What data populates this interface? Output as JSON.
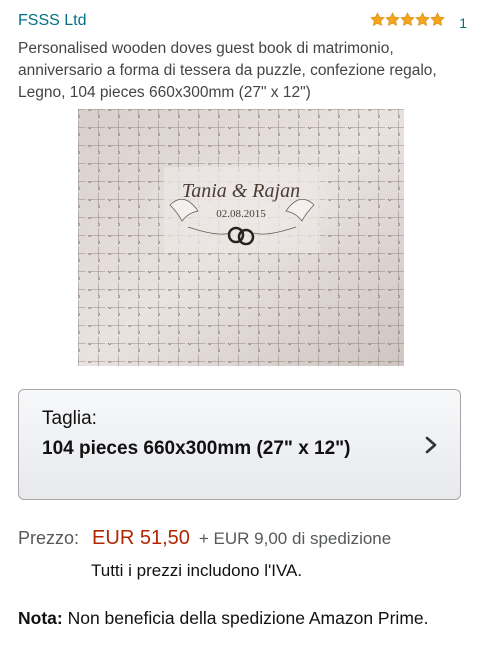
{
  "product": {
    "brand": "FSSS Ltd",
    "rating_count": "1",
    "title": "Personalised wooden doves guest book di matrimonio, anniversario a forma di tessera da puzzle, confezione regalo, Legno, 104 pieces 660x300mm (27\" x 12\")",
    "stars_filled": 5,
    "star_color": "#F4A41D",
    "link_color": "#007185"
  },
  "image": {
    "engraving_names": "Tania & Rajan",
    "engraving_date": "02.08.2015"
  },
  "size_selector": {
    "label": "Taglia:",
    "value": "104 pieces 660x300mm (27\" x 12\")",
    "icon": "chevron-right-icon"
  },
  "pricing": {
    "label": "Prezzo:",
    "price": "EUR 51,50",
    "shipping": "+ EUR 9,00 di spedizione",
    "vat_note": "Tutti i prezzi includono l'IVA.",
    "price_color": "#B12704"
  },
  "note": {
    "label": "Nota:",
    "text": "Non beneficia della spedizione Amazon Prime."
  }
}
